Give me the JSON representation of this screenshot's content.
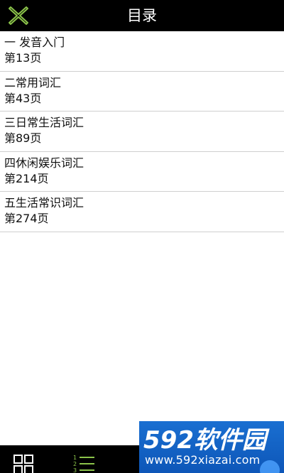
{
  "header": {
    "title": "目录",
    "close_icon": "close-x-icon",
    "accent_color": "#8bc34a"
  },
  "toc": {
    "items": [
      {
        "chapter": "一 发音入门",
        "page": "第13页"
      },
      {
        "chapter": "二常用词汇",
        "page": "第43页"
      },
      {
        "chapter": "三日常生活词汇",
        "page": "第89页"
      },
      {
        "chapter": "四休闲娱乐词汇",
        "page": "第214页"
      },
      {
        "chapter": "五生活常识词汇",
        "page": "第274页"
      }
    ]
  },
  "bottom_bar": {
    "grid_icon": "grid-view-icon",
    "list_icon": "numbered-list-icon",
    "list_numbers": [
      "1",
      "2",
      "3"
    ]
  },
  "watermark": {
    "brand": "592软件园",
    "url": "www.592xiazai.com"
  }
}
